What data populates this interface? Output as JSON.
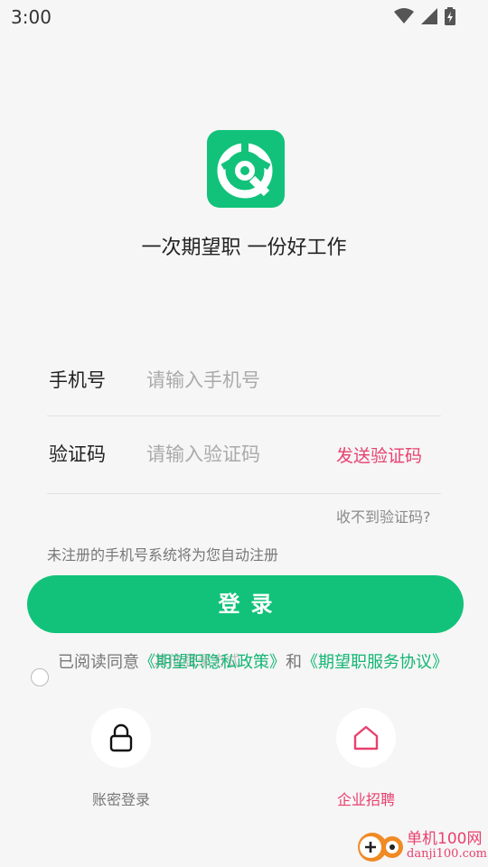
{
  "status_bar": {
    "time": "3:00",
    "icons": [
      "wifi-icon",
      "signal-icon",
      "battery-charging-icon"
    ]
  },
  "brand": {
    "slogan": "一次期望职 一份好工作",
    "color": "#12c27a"
  },
  "form": {
    "phone_label": "手机号",
    "phone_placeholder": "请输入手机号",
    "code_label": "验证码",
    "code_placeholder": "请输入验证码",
    "send_code": "发送验证码",
    "no_code": "收不到验证码?",
    "auto_register_hint": "未注册的手机号系统将为您自动注册"
  },
  "login_button": "登录",
  "other_methods_label": "其他登录方式",
  "agreement": {
    "prefix": "已阅读同意",
    "privacy": "《期望职隐私政策》",
    "and": "和",
    "service": "《期望职服务协议》"
  },
  "alt_login": [
    {
      "label": "账密登录",
      "icon": "lock-icon",
      "color": "#777777"
    },
    {
      "label": "企业招聘",
      "icon": "house-icon",
      "color": "#e8416e"
    }
  ],
  "watermark": {
    "name": "单机100网",
    "url": "danji100.com"
  },
  "colors": {
    "accent": "#12c27a",
    "link": "#12b673",
    "alert": "#e8416e"
  }
}
